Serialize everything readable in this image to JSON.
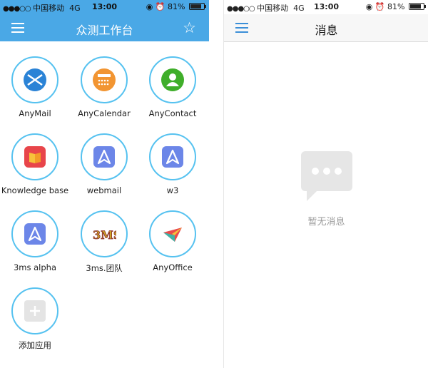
{
  "status_bar": {
    "signal_dots": "●●●○○",
    "carrier": "中国移动",
    "network": "4G",
    "time": "13:00",
    "battery": "81%",
    "battery_level": 0.81
  },
  "left_screen": {
    "title": "众测工作台",
    "accent_color": "#4aa8e6",
    "apps": [
      {
        "label": "AnyMail",
        "icon": "mail-icon"
      },
      {
        "label": "AnyCalendar",
        "icon": "calendar-icon"
      },
      {
        "label": "AnyContact",
        "icon": "contact-icon"
      },
      {
        "label": "Knowledge base",
        "icon": "book-icon"
      },
      {
        "label": "webmail",
        "icon": "arrow-app-icon"
      },
      {
        "label": "w3",
        "icon": "arrow-app-icon"
      },
      {
        "label": "3ms alpha",
        "icon": "arrow-app-icon"
      },
      {
        "label": "3ms.团队",
        "icon": "3ms-logo-icon"
      },
      {
        "label": "AnyOffice",
        "icon": "paper-plane-icon"
      },
      {
        "label": "添加应用",
        "icon": "plus-icon"
      }
    ]
  },
  "right_screen": {
    "title": "消息",
    "empty_text": "暂无消息"
  }
}
